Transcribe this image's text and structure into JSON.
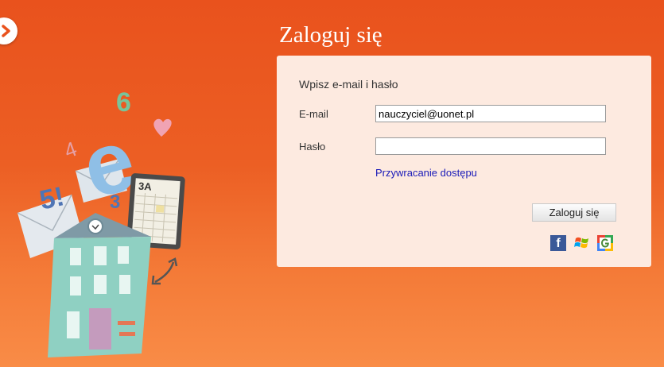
{
  "page": {
    "title": "Zaloguj się"
  },
  "nav": {
    "back_icon": "chevron-right-icon"
  },
  "login_form": {
    "subtitle": "Wpisz e-mail i hasło",
    "email_label": "E-mail",
    "email_value": "nauczyciel@uonet.pl",
    "password_label": "Hasło",
    "password_value": "",
    "recover_link": "Przywracanie dostępu",
    "submit_label": "Zaloguj się",
    "link_color": "#1a1ab8"
  },
  "social_logins": [
    {
      "icon": "facebook-icon",
      "text": "f",
      "color": "#3b5998"
    },
    {
      "icon": "windows-live-icon",
      "colors": [
        "#f25022",
        "#7fba00",
        "#00a4ef",
        "#ffb900"
      ]
    },
    {
      "icon": "google-plus-icon",
      "colors": [
        "#ea4335",
        "#34a853",
        "#4285f4",
        "#fbbc05"
      ]
    }
  ],
  "illustration": {
    "icon": "school-illustration",
    "texts": [
      "6",
      "e",
      "4",
      "5!",
      "3",
      "3A"
    ]
  },
  "colors": {
    "background": "#e9521d",
    "panel": "#fdeae0"
  }
}
